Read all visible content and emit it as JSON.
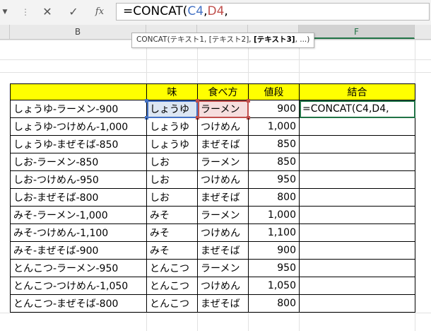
{
  "colors": {
    "header_fill": "#ffff00",
    "selection_green": "#217346",
    "ref_blue": "#4472c4",
    "ref_red": "#c0504d"
  },
  "formula_bar": {
    "cancel_icon": "✕",
    "enter_icon": "✓",
    "fx_label": "fx",
    "formula_prefix": "=CONCAT(",
    "ref1": "C4",
    "comma1": ",",
    "ref2": "D4",
    "comma2": ","
  },
  "columns": {
    "b": "B",
    "f": "F"
  },
  "tooltip": {
    "fn": "CONCAT(",
    "arg1": "テキスト1",
    "sep1": ", ",
    "arg2": "[テキスト2]",
    "sep2": ", ",
    "arg3": "[テキスト3]",
    "rest": ", ...)"
  },
  "table": {
    "headers": [
      "",
      "味",
      "食べ方",
      "値段",
      "結合"
    ],
    "rows": [
      {
        "b": "しょうゆ-ラーメン-900",
        "c": "しょうゆ",
        "d": "ラーメン",
        "e": "900",
        "f": "=CONCAT(C4,D4,"
      },
      {
        "b": "しょうゆ-つけめん-1,000",
        "c": "しょうゆ",
        "d": "つけめん",
        "e": "1,000",
        "f": ""
      },
      {
        "b": "しょうゆ-まぜそば-850",
        "c": "しょうゆ",
        "d": "まぜそば",
        "e": "850",
        "f": ""
      },
      {
        "b": "しお-ラーメン-850",
        "c": "しお",
        "d": "ラーメン",
        "e": "850",
        "f": ""
      },
      {
        "b": "しお-つけめん-950",
        "c": "しお",
        "d": "つけめん",
        "e": "950",
        "f": ""
      },
      {
        "b": "しお-まぜそば-800",
        "c": "しお",
        "d": "まぜそば",
        "e": "800",
        "f": ""
      },
      {
        "b": "みそ-ラーメン-1,000",
        "c": "みそ",
        "d": "ラーメン",
        "e": "1,000",
        "f": ""
      },
      {
        "b": "みそ-つけめん-1,100",
        "c": "みそ",
        "d": "つけめん",
        "e": "1,100",
        "f": ""
      },
      {
        "b": "みそ-まぜそば-900",
        "c": "みそ",
        "d": "まぜそば",
        "e": "900",
        "f": ""
      },
      {
        "b": "とんこつ-ラーメン-950",
        "c": "とんこつ",
        "d": "ラーメン",
        "e": "950",
        "f": ""
      },
      {
        "b": "とんこつ-つけめん-1,050",
        "c": "とんこつ",
        "d": "つけめん",
        "e": "1,050",
        "f": ""
      },
      {
        "b": "とんこつ-まぜそば-800",
        "c": "とんこつ",
        "d": "まぜそば",
        "e": "800",
        "f": ""
      }
    ]
  }
}
